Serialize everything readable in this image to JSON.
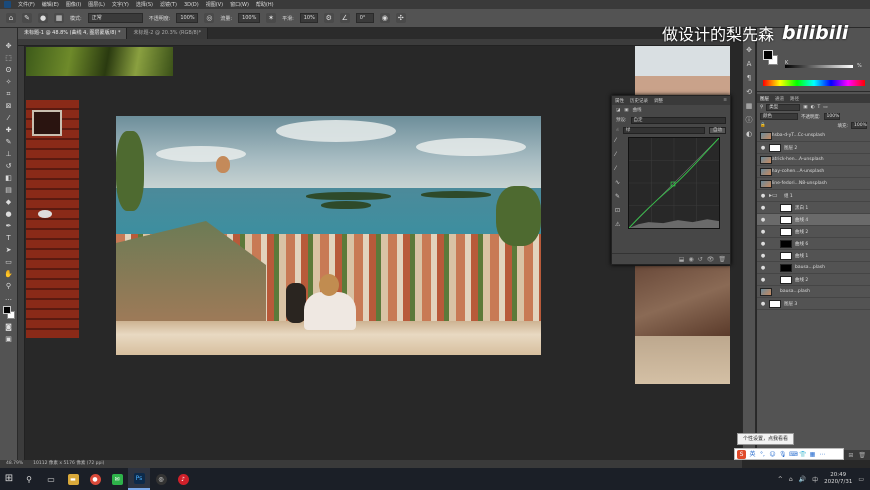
{
  "menubar": {
    "items": [
      "文件(F)",
      "编辑(E)",
      "图像(I)",
      "图层(L)",
      "文字(Y)",
      "选择(S)",
      "滤镜(T)",
      "3D(D)",
      "视图(V)",
      "窗口(W)",
      "帮助(H)"
    ]
  },
  "options": {
    "mode_label": "模式:",
    "mode_value": "正常",
    "opacity_label": "不透明度:",
    "opacity_value": "100%",
    "flow_label": "流量:",
    "flow_value": "100%",
    "smooth_label": "平滑:",
    "smooth_value": "10%",
    "angle_value": "0°"
  },
  "tabs": [
    {
      "label": "未标题-1 @ 48.8% (曲线 4, 图层蒙版/8) *"
    },
    {
      "label": "未标题-2 @ 20.3% (RGB/8)*"
    }
  ],
  "curves": {
    "tabs": [
      "属性",
      "历史记录",
      "调整"
    ],
    "title": "曲线",
    "preset_label": "预设:",
    "preset_value": "自定",
    "channel_value": "绿",
    "auto_label": "自动"
  },
  "color_panel": {
    "k_label": "K",
    "k_value": "%"
  },
  "layers": {
    "tabs": [
      "图层",
      "通道",
      "路径"
    ],
    "filter_value": "类型",
    "blend_value": "颜色",
    "opacity_label": "不透明度:",
    "opacity_value": "100%",
    "fill_label": "填充:",
    "fill_value": "100%",
    "items": [
      {
        "name": "ahsba-d-yT...Cc-unsplash",
        "thumb": "photo",
        "indent": false,
        "sel": false
      },
      {
        "name": "图层 2",
        "thumb": "white",
        "indent": false,
        "sel": false
      },
      {
        "name": "patrick-hen...A-unsplash",
        "thumb": "photo",
        "indent": false,
        "sel": false
      },
      {
        "name": "ohay-cohen...A-unsplash",
        "thumb": "photo",
        "indent": false,
        "sel": false
      },
      {
        "name": "aline-fedori...N8-unsplash",
        "thumb": "photo",
        "indent": false,
        "sel": false
      },
      {
        "name": "组 1",
        "thumb": "folder",
        "indent": false,
        "sel": false
      },
      {
        "name": "黑白 1",
        "thumb": "white",
        "indent": true,
        "sel": false
      },
      {
        "name": "曲线 4",
        "thumb": "white",
        "indent": true,
        "sel": true
      },
      {
        "name": "曲线 2",
        "thumb": "white",
        "indent": true,
        "sel": false
      },
      {
        "name": "曲线 6",
        "thumb": "black",
        "indent": true,
        "sel": false
      },
      {
        "name": "曲线 1",
        "thumb": "white",
        "indent": true,
        "sel": false
      },
      {
        "name": "bausa...plash",
        "thumb": "black",
        "indent": true,
        "sel": false
      },
      {
        "name": "曲线 2",
        "thumb": "white",
        "indent": true,
        "sel": false
      },
      {
        "name": "bausa...plash",
        "thumb": "photo",
        "indent": true,
        "sel": false
      },
      {
        "name": "图层 3",
        "thumb": "white",
        "indent": false,
        "sel": false
      }
    ]
  },
  "status": {
    "zoom": "48.79%",
    "doc": "10112 像素 x 5176 像素 (72 ppi)"
  },
  "watermark": {
    "text_cn": "做设计的梨先森",
    "brand": "bilibili"
  },
  "tooltip": "个性设置，点我看看",
  "taskbar": {
    "time": "20:49",
    "date": "2020/7/31"
  }
}
